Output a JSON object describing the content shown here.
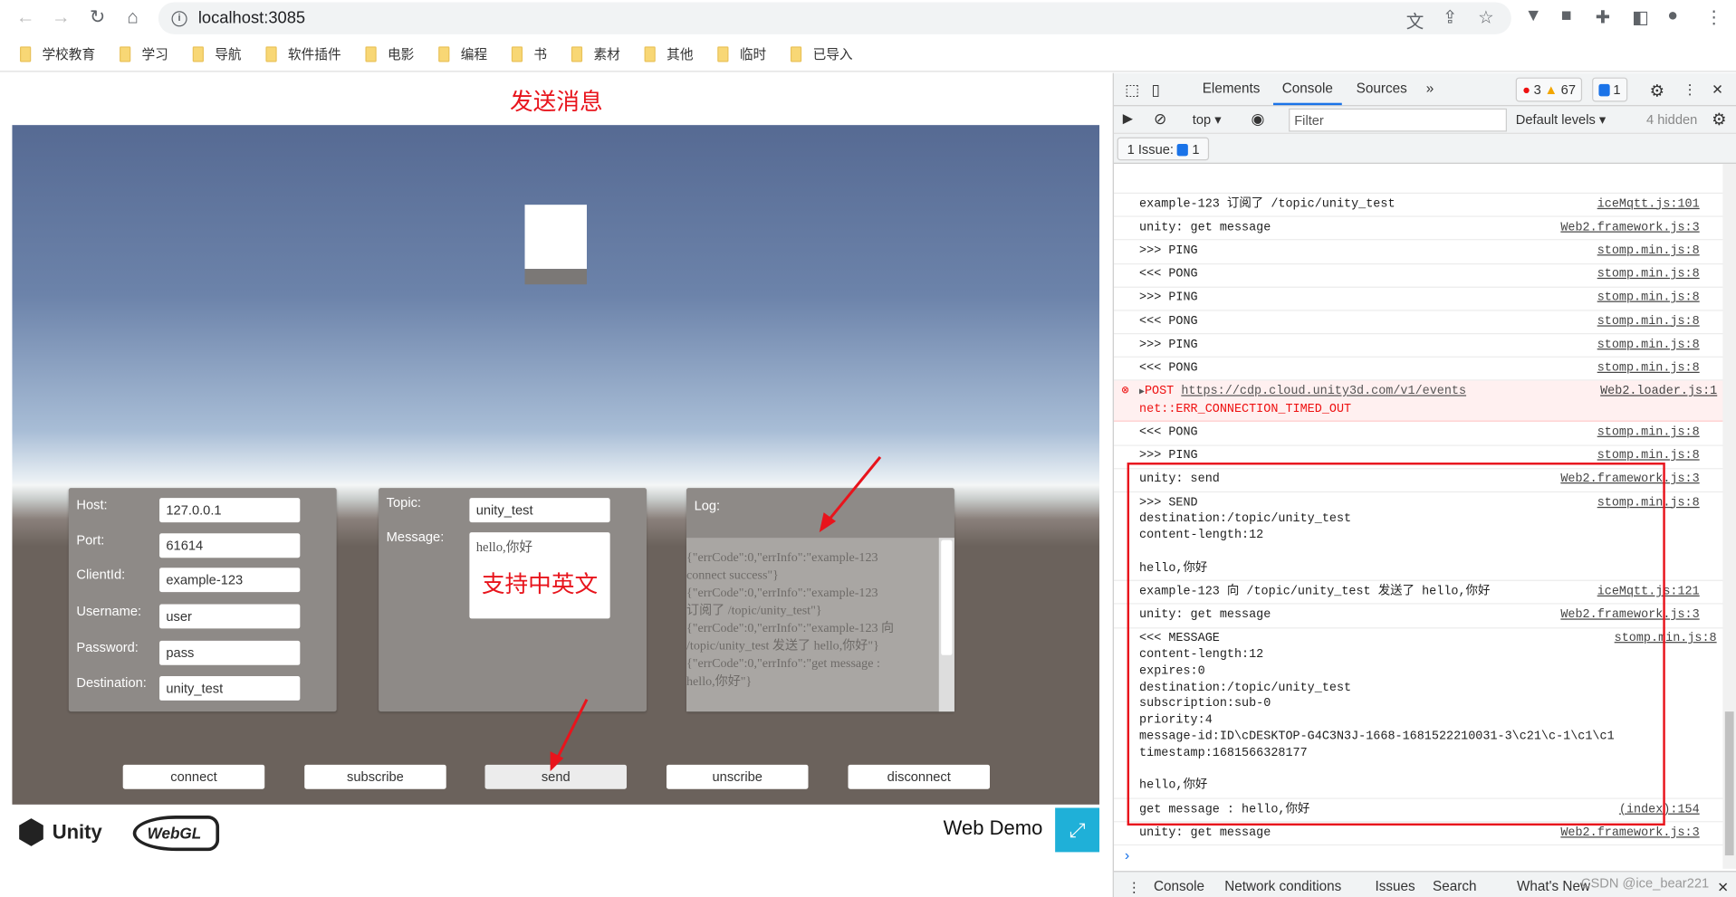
{
  "browser": {
    "url": "localhost:3085",
    "bookmarks": [
      "学校教育",
      "学习",
      "导航",
      "软件插件",
      "电影",
      "编程",
      "书",
      "素材",
      "其他",
      "临时",
      "已导入"
    ]
  },
  "page": {
    "title": "发送消息",
    "annotation": "支持中英文",
    "conn_panel": {
      "fields": [
        {
          "label": "Host:",
          "value": "127.0.0.1"
        },
        {
          "label": "Port:",
          "value": "61614"
        },
        {
          "label": "ClientId:",
          "value": "example-123"
        },
        {
          "label": "Username:",
          "value": "user"
        },
        {
          "label": "Password:",
          "value": "pass"
        },
        {
          "label": "Destination:",
          "value": "unity_test"
        }
      ]
    },
    "msg_panel": {
      "topic_label": "Topic:",
      "topic_value": "unity_test",
      "message_label": "Message:",
      "message_value": "hello,你好"
    },
    "log_panel": {
      "label": "Log:",
      "text": "{\"errCode\":0,\"errInfo\":\"example-123\nconnect success\"}\n{\"errCode\":0,\"errInfo\":\"example-123\n订阅了 /topic/unity_test\"}\n{\"errCode\":0,\"errInfo\":\"example-123 向\n/topic/unity_test 发送了 hello,你好\"}\n{\"errCode\":0,\"errInfo\":\"get message :\nhello,你好\"}"
    },
    "buttons": [
      "connect",
      "subscribe",
      "send",
      "unscribe",
      "disconnect"
    ],
    "footer": {
      "unity": "Unity",
      "webgl": "WebGL",
      "demo": "Web Demo"
    }
  },
  "devtools": {
    "tabs": [
      "Elements",
      "Console",
      "Sources"
    ],
    "active_tab": "Console",
    "errors": "3",
    "warnings": "67",
    "messages": "1",
    "context": "top",
    "filter_placeholder": "Filter",
    "levels": "Default levels",
    "hidden": "4 hidden",
    "issues": "1 Issue:",
    "issues_count": "1",
    "rows": [
      {
        "msg": "example-123 订阅了 /topic/unity_test",
        "src": "iceMqtt.js:101"
      },
      {
        "msg": "unity: get message",
        "src": "Web2.framework.js:3"
      },
      {
        "msg": ">>> PING",
        "src": "stomp.min.js:8"
      },
      {
        "msg": "<<< PONG",
        "src": "stomp.min.js:8"
      },
      {
        "msg": ">>> PING",
        "src": "stomp.min.js:8"
      },
      {
        "msg": "<<< PONG",
        "src": "stomp.min.js:8"
      },
      {
        "msg": ">>> PING",
        "src": "stomp.min.js:8"
      },
      {
        "msg": "<<< PONG",
        "src": "stomp.min.js:8"
      },
      {
        "error": true,
        "method": "POST",
        "url": "https://cdp.cloud.unity3d.com/v1/events",
        "msg": "net::ERR_CONNECTION_TIMED_OUT",
        "src": "Web2.loader.js:1"
      },
      {
        "msg": "<<< PONG",
        "src": "stomp.min.js:8"
      },
      {
        "msg": ">>> PING",
        "src": "stomp.min.js:8"
      },
      {
        "msg": "unity: send",
        "src": "Web2.framework.js:3"
      },
      {
        "msg": ">>> SEND\ndestination:/topic/unity_test\ncontent-length:12\n\nhello,你好",
        "src": "stomp.min.js:8"
      },
      {
        "msg": "example-123 向 /topic/unity_test 发送了 hello,你好",
        "src": "iceMqtt.js:121"
      },
      {
        "msg": "unity: get message",
        "src": "Web2.framework.js:3"
      },
      {
        "msg": "<<< MESSAGE\ncontent-length:12\nexpires:0\ndestination:/topic/unity_test\nsubscription:sub-0\npriority:4\nmessage-id:ID\\cDESKTOP-G4C3N3J-1668-1681522210031-3\\c21\\c-1\\c1\\c1\ntimestamp:1681566328177\n\nhello,你好",
        "src": "stomp.min.js:8"
      },
      {
        "msg": "get message : hello,你好",
        "src": "(index):154"
      },
      {
        "msg": "unity: get message",
        "src": "Web2.framework.js:3"
      }
    ],
    "drawer": [
      "Console",
      "Network conditions",
      "Issues",
      "Search",
      "What's New"
    ]
  },
  "watermark": "CSDN @ice_bear221",
  "colors": {
    "accent": "#1a73e8",
    "annotation": "#e8141c",
    "fullscreen": "#1fb0d8"
  }
}
